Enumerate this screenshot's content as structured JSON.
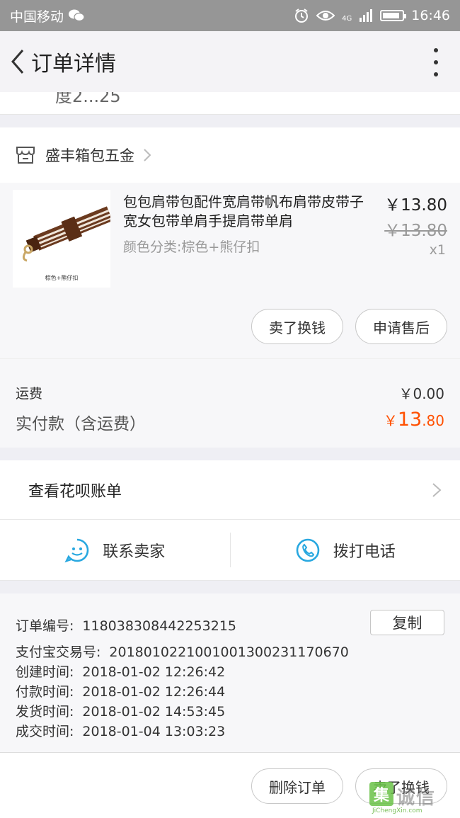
{
  "status_bar": {
    "carrier": "中国移动",
    "network": "4G",
    "time": "16:46",
    "battery_level": 0.75
  },
  "header": {
    "title": "订单详情"
  },
  "partial_top_text": "度2...25",
  "shop": {
    "name": "盛丰箱包五金"
  },
  "product": {
    "title": "包包肩带包配件宽肩带帆布肩带皮带子宽女包带单肩手提肩带单肩",
    "spec": "颜色分类:棕色+熊仔扣",
    "image_caption": "棕色+熊仔扣",
    "price": "￥13.80",
    "original_price": "￥13.80",
    "quantity": "x1",
    "btn_sell": "卖了换钱",
    "btn_aftersale": "申请售后"
  },
  "payment": {
    "shipping_label": "运费",
    "shipping_value": "￥0.00",
    "total_label": "实付款（含运费）",
    "total_currency": "￥",
    "total_int": "13",
    "total_dec": ".80"
  },
  "huabei": {
    "label": "查看花呗账单"
  },
  "contact": {
    "seller": "联系卖家",
    "phone": "拨打电话"
  },
  "order_info": {
    "copy_label": "复制",
    "rows": [
      {
        "label": "订单编号:",
        "value": "118038308442253215"
      },
      {
        "label": "支付宝交易号:",
        "value": "2018010221001001300231170670"
      },
      {
        "label": "创建时间:",
        "value": "2018-01-02 12:26:42"
      },
      {
        "label": "付款时间:",
        "value": "2018-01-02 12:26:44"
      },
      {
        "label": "发货时间:",
        "value": "2018-01-02 14:53:45"
      },
      {
        "label": "成交时间:",
        "value": "2018-01-04 13:03:23"
      }
    ]
  },
  "bottom": {
    "delete_order": "删除订单",
    "sell": "卖了换钱"
  },
  "watermark": {
    "brand": "诚信",
    "url": "JiChengXin.com",
    "accent_color": "#6ac248"
  },
  "colors": {
    "accent_orange": "#ff5000",
    "icon_blue": "#29a8e0"
  }
}
